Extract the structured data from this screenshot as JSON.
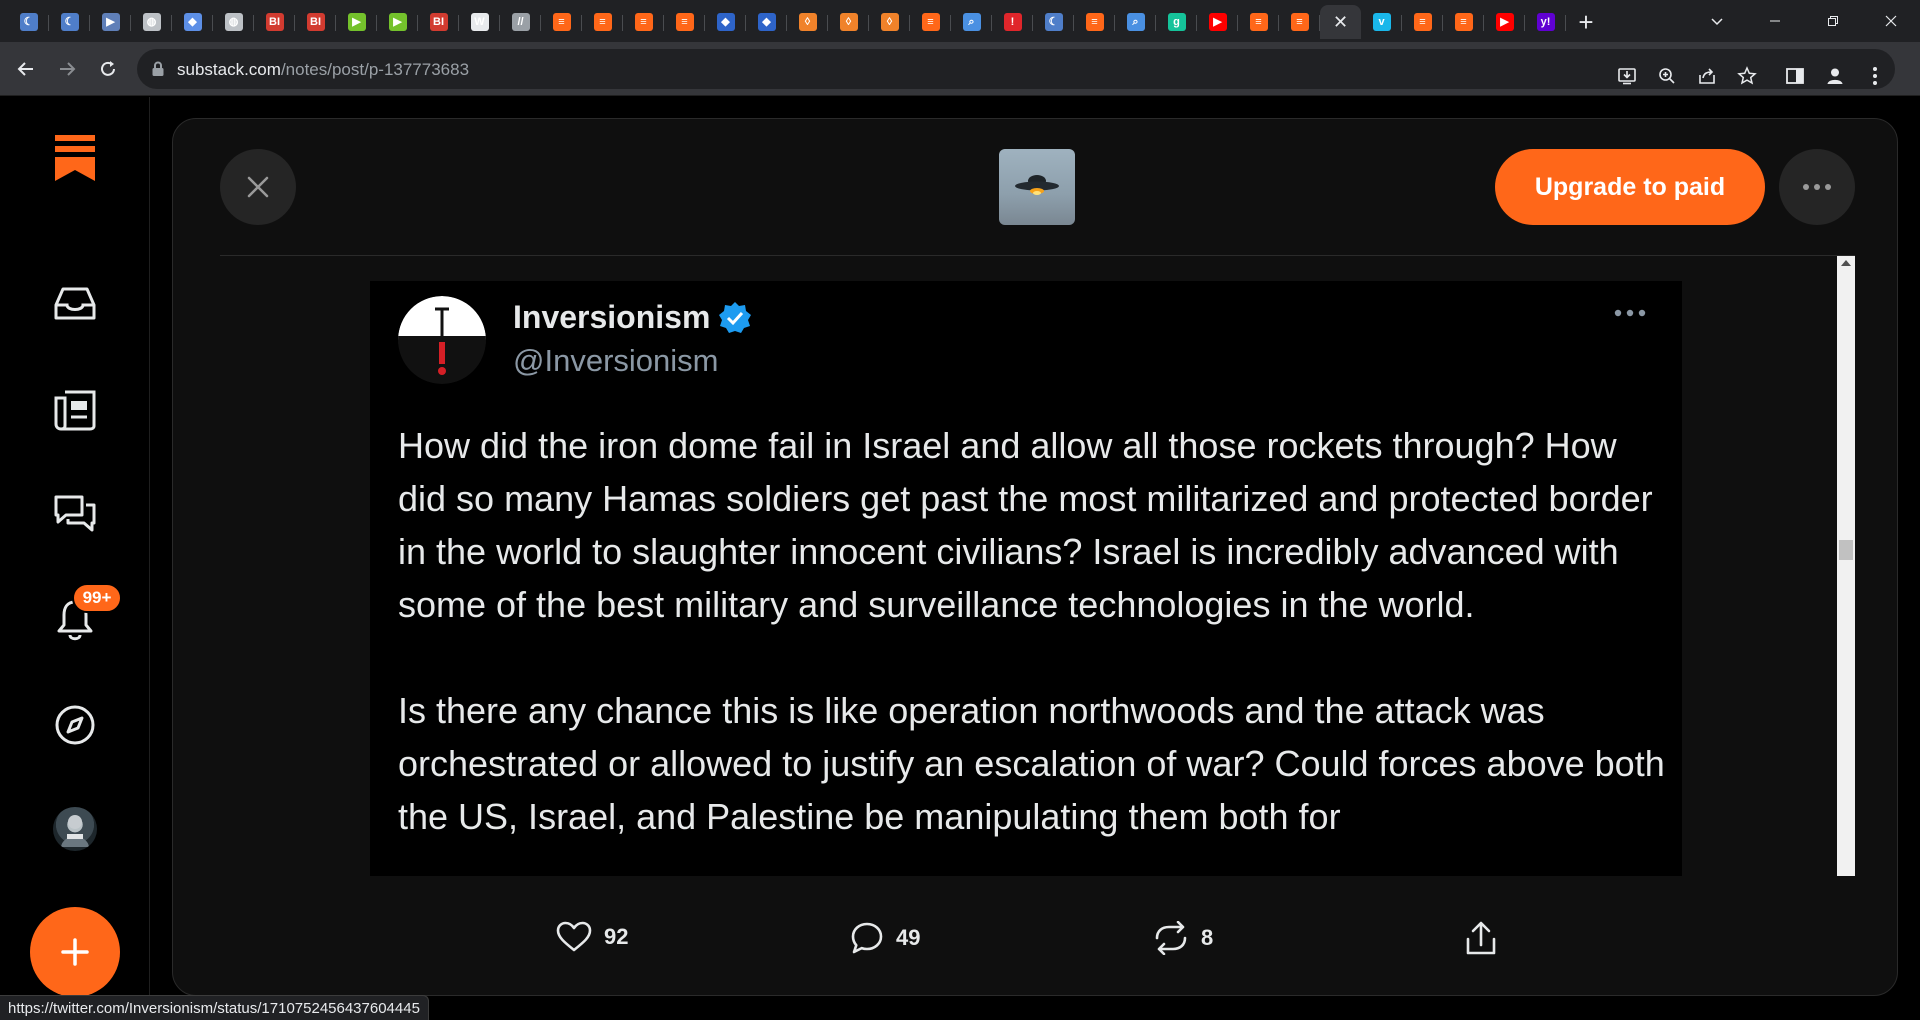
{
  "browser": {
    "tabs": [
      {
        "icon": "teal-crescent",
        "color": "#4f7ec9",
        "glyph": "☾"
      },
      {
        "icon": "teal-crescent",
        "color": "#4f7ec9",
        "glyph": "☾"
      },
      {
        "icon": "blue-arrow",
        "color": "#5f7fb8",
        "glyph": "▶"
      },
      {
        "icon": "globe",
        "color": "#bdc1c6",
        "glyph": "◍"
      },
      {
        "icon": "graduation-cap",
        "color": "#5d8fe6",
        "glyph": "◆"
      },
      {
        "icon": "globe",
        "color": "#bdc1c6",
        "glyph": "◍"
      },
      {
        "icon": "business-insider",
        "color": "#d23b30",
        "glyph": "BI"
      },
      {
        "icon": "business-insider",
        "color": "#d23b30",
        "glyph": "BI"
      },
      {
        "icon": "rumble-play",
        "color": "#74c12c",
        "glyph": "▶"
      },
      {
        "icon": "rumble-play",
        "color": "#74c12c",
        "glyph": "▶"
      },
      {
        "icon": "business-insider",
        "color": "#d23b30",
        "glyph": "BI"
      },
      {
        "icon": "news-logo",
        "color": "#e8eaed",
        "glyph": "W"
      },
      {
        "icon": "slash-logo",
        "color": "#9aa0a6",
        "glyph": "//"
      },
      {
        "icon": "substack",
        "color": "#ff6719",
        "glyph": "≡"
      },
      {
        "icon": "substack",
        "color": "#ff6719",
        "glyph": "≡"
      },
      {
        "icon": "substack",
        "color": "#ff6719",
        "glyph": "≡"
      },
      {
        "icon": "substack",
        "color": "#ff6719",
        "glyph": "≡"
      },
      {
        "icon": "blue-cube",
        "color": "#2e64c9",
        "glyph": "◆"
      },
      {
        "icon": "blue-cube",
        "color": "#2e64c9",
        "glyph": "◆"
      },
      {
        "icon": "orange-shield",
        "color": "#f0822a",
        "glyph": "◊"
      },
      {
        "icon": "orange-shield",
        "color": "#f0822a",
        "glyph": "◊"
      },
      {
        "icon": "orange-shield",
        "color": "#f0822a",
        "glyph": "◊"
      },
      {
        "icon": "substack",
        "color": "#ff6719",
        "glyph": "≡"
      },
      {
        "icon": "search",
        "color": "#4a90e2",
        "glyph": "⌕"
      },
      {
        "icon": "red-pin",
        "color": "#e0262b",
        "glyph": "!"
      },
      {
        "icon": "teal-crescent",
        "color": "#4f7ec9",
        "glyph": "☾"
      },
      {
        "icon": "substack",
        "color": "#ff6719",
        "glyph": "≡"
      },
      {
        "icon": "search",
        "color": "#4a90e2",
        "glyph": "⌕"
      },
      {
        "icon": "green-g",
        "color": "#15c39a",
        "glyph": "g"
      },
      {
        "icon": "youtube",
        "color": "#ff0000",
        "glyph": "▶"
      },
      {
        "icon": "substack",
        "color": "#ff6719",
        "glyph": "≡"
      },
      {
        "icon": "substack",
        "color": "#ff6719",
        "glyph": "≡"
      }
    ],
    "active_tab": {
      "icon": "close-icon",
      "label": "✕"
    },
    "tabs_after": [
      {
        "icon": "vimeo",
        "color": "#1ab7ea",
        "glyph": "v"
      },
      {
        "icon": "substack",
        "color": "#ff6719",
        "glyph": "≡"
      },
      {
        "icon": "substack",
        "color": "#ff6719",
        "glyph": "≡"
      },
      {
        "icon": "youtube",
        "color": "#ff0000",
        "glyph": "▶"
      },
      {
        "icon": "yahoo",
        "color": "#6001d2",
        "glyph": "y!"
      }
    ],
    "new_tab_label": "+",
    "url_host": "substack.com",
    "url_path": "/notes/post/p-137773683",
    "status_url": "https://twitter.com/Inversionism/status/1710752456437604445"
  },
  "sidebar": {
    "badge": "99+"
  },
  "modal": {
    "upgrade_label": "Upgrade to paid",
    "tweet": {
      "name": "Inversionism",
      "handle": "@Inversionism",
      "paragraphs": [
        "How did the iron dome fail in Israel and allow all those rockets through? How did so many Hamas soldiers get past the most militarized and protected border in the world to slaughter innocent civilians? Israel is incredibly advanced with some of the best military and surveillance technologies in the world.",
        "Is there any chance this is like operation northwoods and the attack was orchestrated or allowed to justify an escalation of war? Could forces above both the US, Israel, and Palestine be manipulating them both for"
      ]
    },
    "actions": {
      "likes": "92",
      "comments": "49",
      "restacks": "8"
    }
  },
  "colors": {
    "accent": "#ff6719",
    "verified": "#1d9bf0"
  }
}
